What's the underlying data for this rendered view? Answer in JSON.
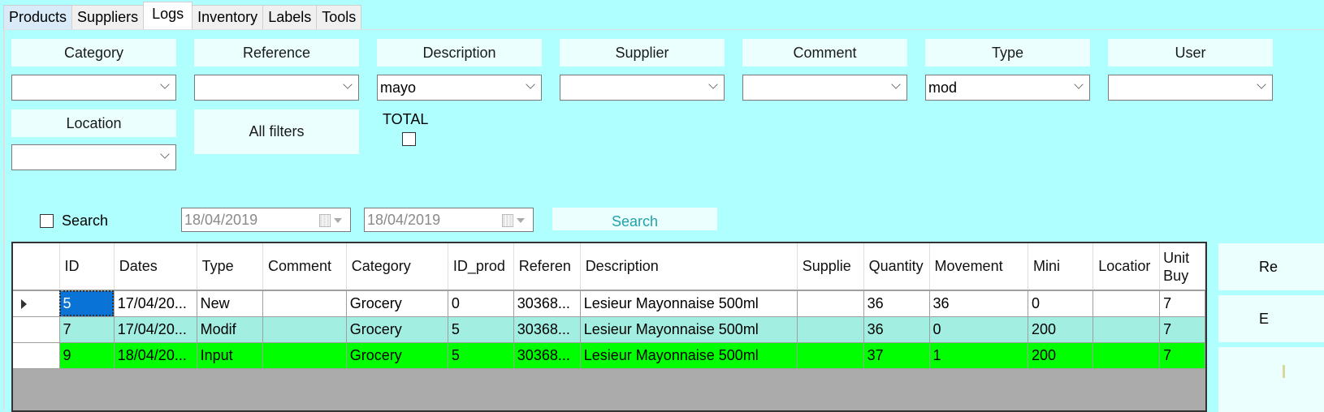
{
  "tabs": [
    {
      "label": "Products"
    },
    {
      "label": "Suppliers"
    },
    {
      "label": "Logs",
      "active": true
    },
    {
      "label": "Inventory"
    },
    {
      "label": "Labels"
    },
    {
      "label": "Tools"
    }
  ],
  "filters": {
    "category": {
      "label": "Category",
      "value": ""
    },
    "reference": {
      "label": "Reference",
      "value": ""
    },
    "description": {
      "label": "Description",
      "value": "mayo"
    },
    "supplier": {
      "label": "Supplier",
      "value": ""
    },
    "comment": {
      "label": "Comment",
      "value": ""
    },
    "type": {
      "label": "Type",
      "value": "mod"
    },
    "user": {
      "label": "User",
      "value": ""
    },
    "location": {
      "label": "Location",
      "value": ""
    },
    "all_filters_label": "All filters",
    "total_label": "TOTAL",
    "total_checked": false
  },
  "search": {
    "checkbox_label": "Search",
    "checked": false,
    "date_from": "18/04/2019",
    "date_to": "18/04/2019",
    "button_label": "Search"
  },
  "grid": {
    "columns": [
      "ID",
      "Dates",
      "Type",
      "Comment",
      "Category",
      "ID_prod",
      "Referen",
      "Description",
      "Supplie",
      "Quantity",
      "Movement",
      "Mini",
      "Locatior",
      "Unit Buy"
    ],
    "rows": [
      [
        "5",
        "17/04/20...",
        "New",
        "",
        "Grocery",
        "0",
        "30368...",
        "Lesieur Mayonnaise 500ml",
        "",
        "36",
        "36",
        "0",
        "",
        "7"
      ],
      [
        "7",
        "17/04/20...",
        "Modif",
        "",
        "Grocery",
        "5",
        "30368...",
        "Lesieur Mayonnaise 500ml",
        "",
        "36",
        "0",
        "200",
        "",
        "7"
      ],
      [
        "9",
        "18/04/20...",
        "Input",
        "",
        "Grocery",
        "5",
        "30368...",
        "Lesieur Mayonnaise 500ml",
        "",
        "37",
        "1",
        "200",
        "",
        "7"
      ]
    ],
    "row_colors": [
      "#ffffff",
      "#a2efe2",
      "#00ff00"
    ],
    "selected_cell": {
      "row": 0,
      "col": 0
    }
  },
  "side_buttons": [
    {
      "label": "Re"
    },
    {
      "label": "E"
    },
    {
      "label": ""
    }
  ]
}
